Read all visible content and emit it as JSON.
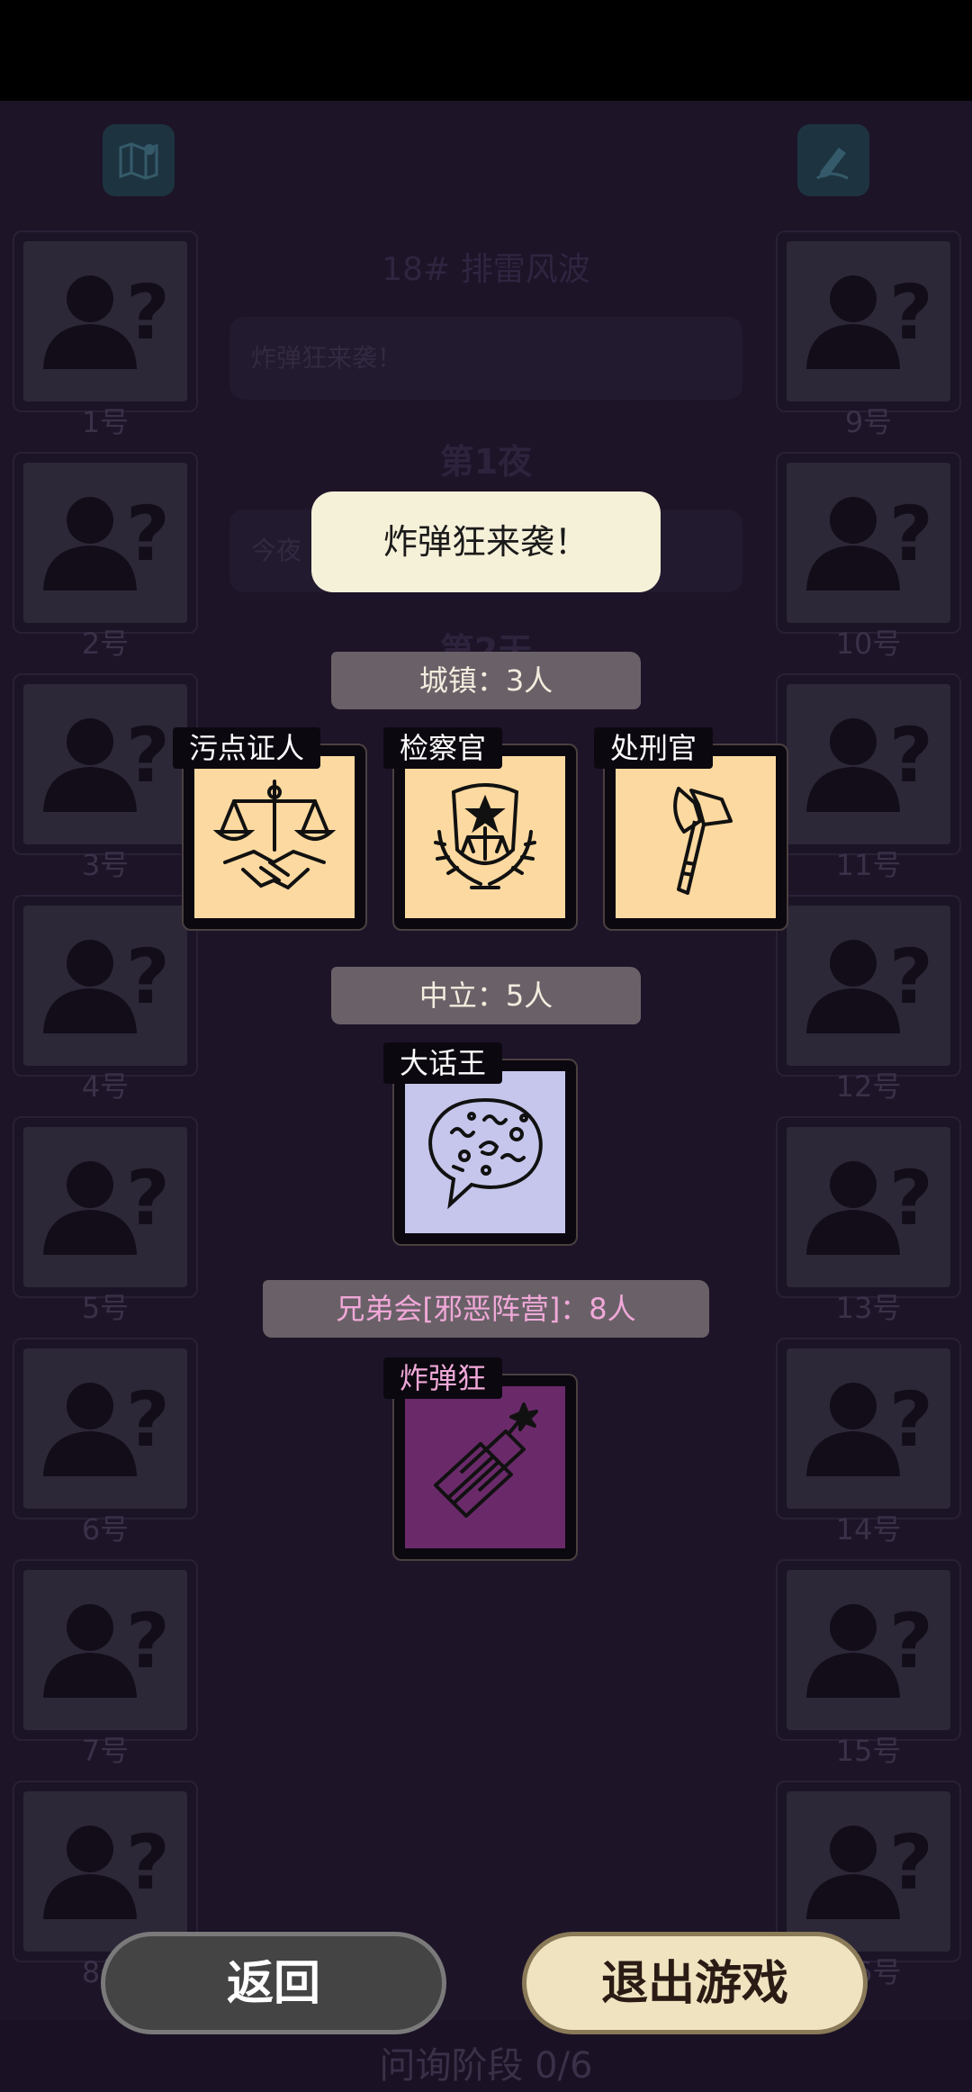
{
  "header": {
    "room_title": "18#  排雷风波"
  },
  "log": {
    "message1": "炸弹狂来袭！",
    "night_heading": "第1夜",
    "message2": "今夜",
    "day_heading": "第2天"
  },
  "players": {
    "left": [
      "1号",
      "2号",
      "3号",
      "4号",
      "5号",
      "6号",
      "7号",
      "8号"
    ],
    "right": [
      "9号",
      "10号",
      "11号",
      "12号",
      "13号",
      "14号",
      "15号",
      "16号"
    ]
  },
  "popup": {
    "toast": "炸弹狂来袭！",
    "factions": [
      {
        "banner": "城镇：3人",
        "roles": [
          "污点证人",
          "检察官",
          "处刑官"
        ]
      },
      {
        "banner": "中立：5人",
        "roles": [
          "大话王"
        ]
      },
      {
        "banner": "兄弟会[邪恶阵营]：8人",
        "roles": [
          "炸弹狂"
        ]
      }
    ]
  },
  "buttons": {
    "back": "返回",
    "quit": "退出游戏"
  },
  "footer": {
    "phase": "问询阶段 0/6"
  },
  "colors": {
    "town_card": "#fcd9a0",
    "neutral_card": "#c6c6ec",
    "evil_card": "#6a2a6a",
    "evil_text": "#f0a8d8"
  },
  "icons": [
    "map-icon",
    "edit-icon",
    "unknown-player-icon",
    "scales-handshake-icon",
    "prosecutor-badge-icon",
    "axe-icon",
    "speech-bubble-icon",
    "dynamite-icon"
  ]
}
